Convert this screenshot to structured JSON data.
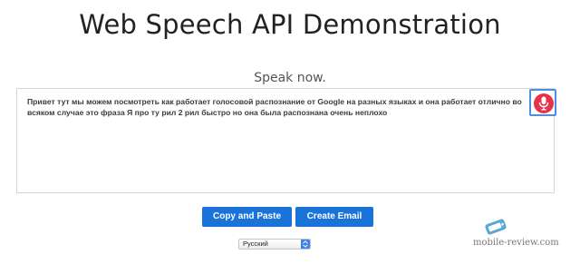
{
  "page": {
    "title": "Web Speech API Demonstration",
    "status": "Speak now."
  },
  "transcript": {
    "text": "Привет тут мы можем посмотреть как работает голосовой распознание от Google на разных языках и она работает отлично во всяком случае это фраза Я про ту рил 2 рил быстро но она была распознана очень неплохо"
  },
  "mic_button": {
    "icon": "microphone-icon",
    "state": "listening",
    "color": "#e8324a",
    "focus_color": "#4d8ee3"
  },
  "buttons": {
    "copy_label": "Copy and Paste",
    "email_label": "Create Email",
    "color": "#1a73d9"
  },
  "language_select": {
    "selected": "Русский",
    "icon": "updown-arrows-icon"
  },
  "watermark": {
    "text": "mobile-review.com"
  }
}
